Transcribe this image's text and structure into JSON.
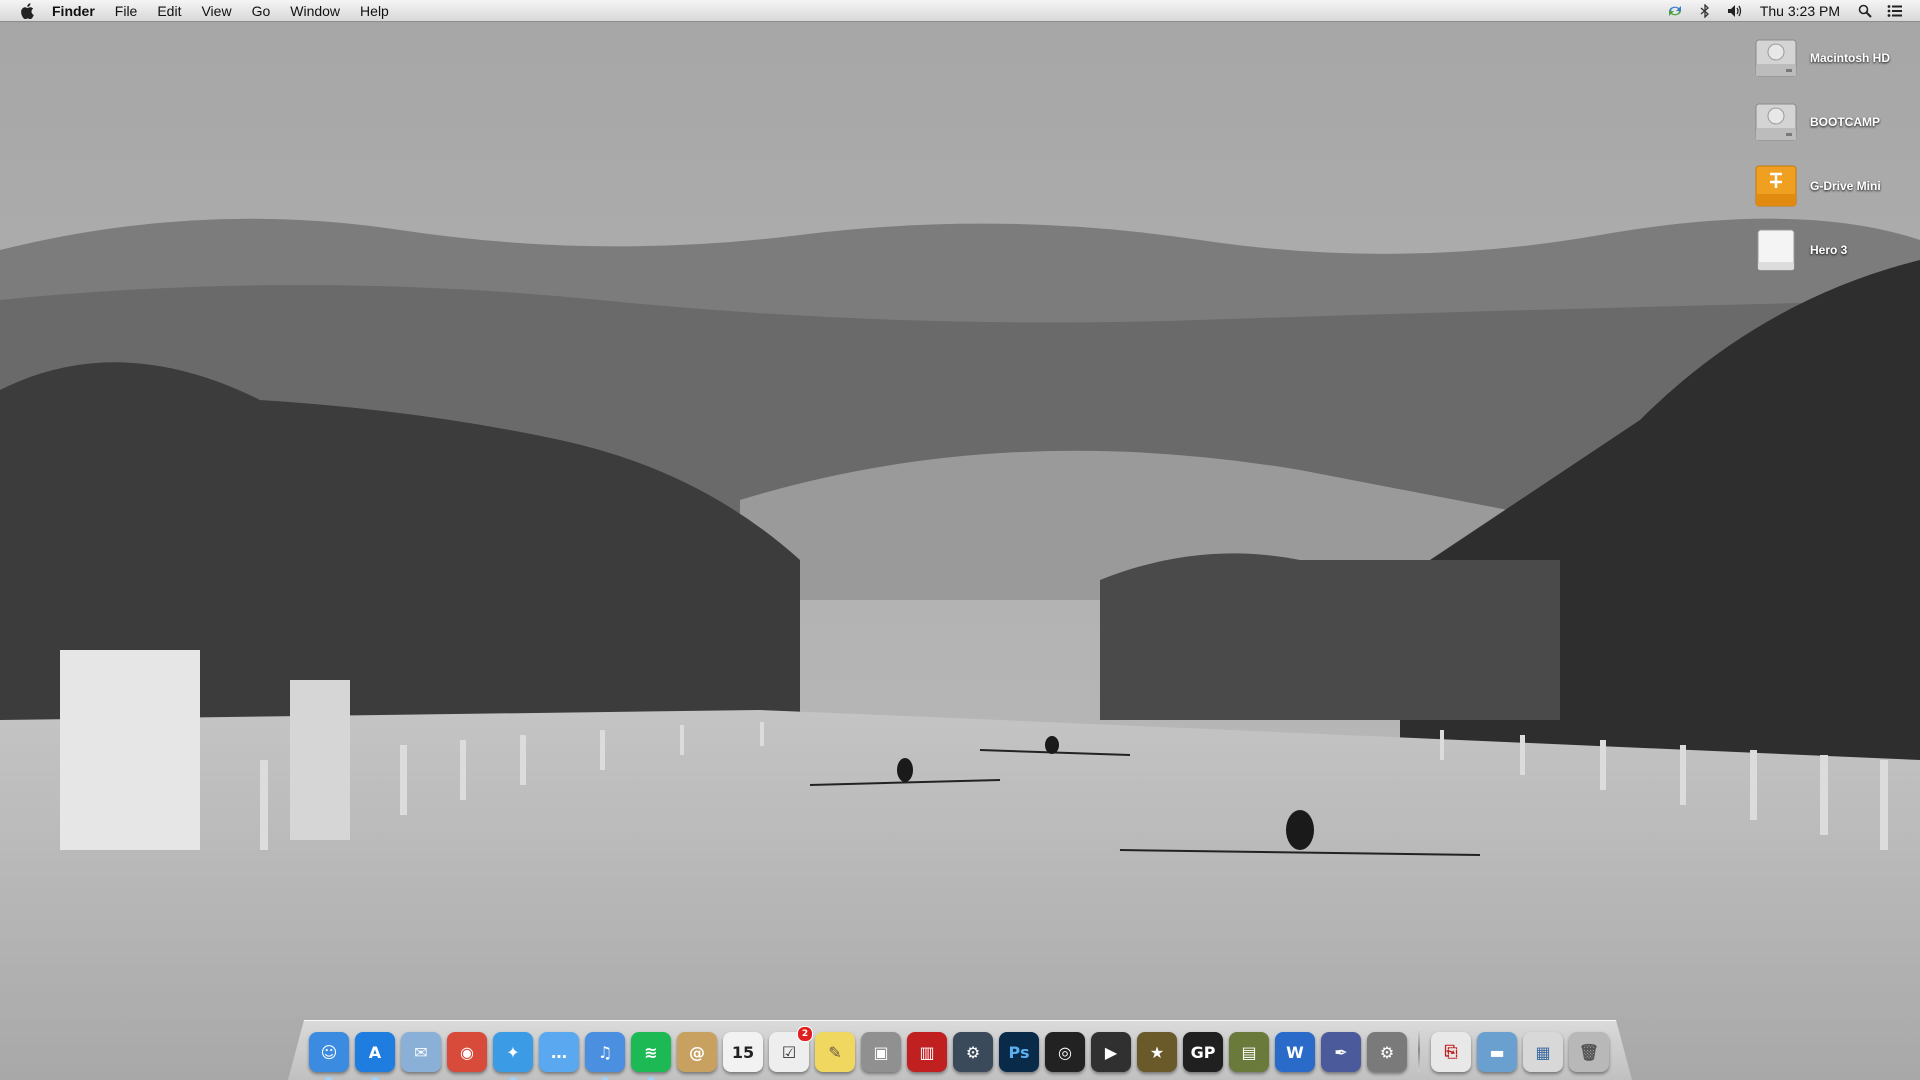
{
  "menubar": {
    "apple_icon": "apple-icon",
    "app_name": "Finder",
    "menus": [
      "File",
      "Edit",
      "View",
      "Go",
      "Window",
      "Help"
    ],
    "status_icons": [
      "sync-icon",
      "bluetooth-icon",
      "volume-icon"
    ],
    "clock": "Thu 3:23 PM",
    "right_icons": [
      "spotlight-icon",
      "notification-list-icon"
    ]
  },
  "desktop_icons": [
    {
      "label": "Macintosh HD",
      "icon": "hard-drive-icon"
    },
    {
      "label": "BOOTCAMP",
      "icon": "hard-drive-icon"
    },
    {
      "label": "G-Drive Mini",
      "icon": "firewire-drive-icon"
    },
    {
      "label": "Hero 3",
      "icon": "removable-drive-icon"
    }
  ],
  "dock": {
    "apps": [
      {
        "name": "finder",
        "glyph": "☺",
        "color": "#3b8be0"
      },
      {
        "name": "app-store",
        "glyph": "A",
        "color": "#1f7de0"
      },
      {
        "name": "preview",
        "glyph": "✉",
        "color": "#8ab0d8"
      },
      {
        "name": "chrome",
        "glyph": "◉",
        "color": "#d84b3a"
      },
      {
        "name": "safari",
        "glyph": "✦",
        "color": "#3c9be5"
      },
      {
        "name": "messages",
        "glyph": "…",
        "color": "#5aa8f0"
      },
      {
        "name": "itunes",
        "glyph": "♫",
        "color": "#4a8fe0"
      },
      {
        "name": "spotify",
        "glyph": "≋",
        "color": "#1db954"
      },
      {
        "name": "contacts",
        "glyph": "@",
        "color": "#c8a060"
      },
      {
        "name": "calendar",
        "glyph": "15",
        "color": "#f2f2f2",
        "text_color": "#222"
      },
      {
        "name": "reminders",
        "glyph": "☑",
        "color": "#eeeeee",
        "text_color": "#333",
        "badge": "2"
      },
      {
        "name": "stickies",
        "glyph": "✎",
        "color": "#f0d860",
        "text_color": "#654"
      },
      {
        "name": "scanner",
        "glyph": "▣",
        "color": "#909090"
      },
      {
        "name": "photo-booth",
        "glyph": "▥",
        "color": "#c02020"
      },
      {
        "name": "steam",
        "glyph": "⚙",
        "color": "#3a4a5a"
      },
      {
        "name": "photoshop",
        "glyph": "Ps",
        "color": "#0a2a4a",
        "text_color": "#5ab0f0"
      },
      {
        "name": "aperture",
        "glyph": "◎",
        "color": "#222222"
      },
      {
        "name": "final-cut",
        "glyph": "▶",
        "color": "#303030"
      },
      {
        "name": "imovie",
        "glyph": "★",
        "color": "#6a5a2a"
      },
      {
        "name": "gopro",
        "glyph": "GP",
        "color": "#202020"
      },
      {
        "name": "textbook",
        "glyph": "▤",
        "color": "#6a7a3a"
      },
      {
        "name": "word",
        "glyph": "W",
        "color": "#2a6ac8"
      },
      {
        "name": "script-editor",
        "glyph": "✒",
        "color": "#4a5a9a"
      },
      {
        "name": "system-preferences",
        "glyph": "⚙",
        "color": "#7a7a7a"
      }
    ],
    "stacks": [
      {
        "name": "pdf-stack",
        "glyph": "⎘",
        "color": "#e8e8e8",
        "text_color": "#c02020"
      },
      {
        "name": "folder-stack",
        "glyph": "▬",
        "color": "#6aa0d0"
      },
      {
        "name": "downloads-stack",
        "glyph": "▦",
        "color": "#d8d8d8",
        "text_color": "#3a6aa0"
      },
      {
        "name": "trash",
        "glyph": "🗑",
        "color": "#b8b8b8",
        "text_color": "#555"
      }
    ],
    "running": [
      "finder",
      "app-store",
      "safari",
      "itunes",
      "spotify"
    ]
  }
}
